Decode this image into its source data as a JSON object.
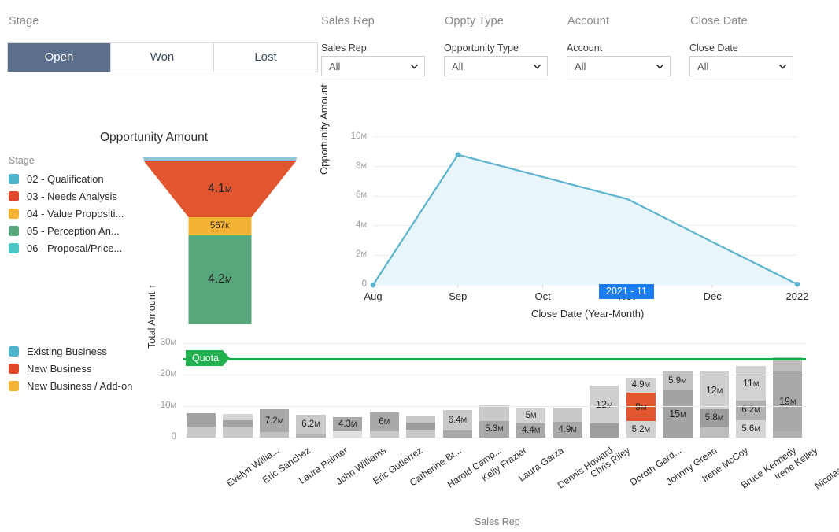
{
  "filters": {
    "stage": {
      "group_title": "Stage",
      "options": [
        "Open",
        "Won",
        "Lost"
      ],
      "selected": "Open"
    },
    "dropdowns": [
      {
        "group_title": "Sales Rep",
        "label": "Sales Rep",
        "value": "All",
        "icon": "chevron-down-icon"
      },
      {
        "group_title": "Oppty Type",
        "label": "Opportunity Type",
        "value": "All",
        "icon": "chevron-down-icon"
      },
      {
        "group_title": "Account",
        "label": "Account",
        "value": "All",
        "icon": "chevron-down-icon"
      },
      {
        "group_title": "Close Date",
        "label": "Close Date",
        "value": "All",
        "icon": "chevron-down-icon"
      }
    ]
  },
  "funnel_panel": {
    "title": "Opportunity Amount",
    "legend_title": "Stage",
    "legend": [
      {
        "label": "02 - Qualification",
        "color": "#4eb3cd"
      },
      {
        "label": "03 - Needs Analysis",
        "color": "#e1482b"
      },
      {
        "label": "04 - Value Propositi...",
        "color": "#f5b335"
      },
      {
        "label": "05 - Perception An...",
        "color": "#56a87c"
      },
      {
        "label": "06 - Proposal/Price...",
        "color": "#4ac6c6"
      }
    ]
  },
  "chart_data": [
    {
      "type": "funnel",
      "title": "Opportunity Amount",
      "stages": [
        {
          "label": "02 - Qualification",
          "value_label": "",
          "value": 0.03,
          "color": "#8fc5d4",
          "show_label": false
        },
        {
          "label": "03 - Needs Analysis",
          "value_label": "4.1M",
          "value": 4.1,
          "color": "#e1552f",
          "show_label": true
        },
        {
          "label": "04 - Value Propositi...",
          "value_label": "567K",
          "value": 0.567,
          "color": "#f5b335",
          "show_label": true
        },
        {
          "label": "05 - Perception An...",
          "value_label": "4.2M",
          "value": 4.2,
          "color": "#56a87c",
          "show_label": true
        }
      ]
    },
    {
      "type": "area",
      "title": "",
      "xlabel": "Close Date (Year-Month)",
      "ylabel": "Opportunity Amount",
      "x": [
        "Aug",
        "Sep",
        "Oct",
        "Nov",
        "Dec",
        "2022"
      ],
      "values": [
        0,
        8.8,
        7.3,
        5.8,
        2.9,
        0.05
      ],
      "ylim": [
        0,
        10
      ],
      "yticks": [
        "0",
        "2M",
        "4M",
        "6M",
        "8M",
        "10M"
      ],
      "grid": true,
      "line_color": "#5cb3cf",
      "fill_color": "#e8f5fa",
      "tooltip": "2021 - 11"
    },
    {
      "type": "bar",
      "stacked": true,
      "xlabel": "Sales Rep",
      "ylabel": "Total Amount ↑",
      "ylim": [
        0,
        30
      ],
      "yticks": [
        "0",
        "10M",
        "20M",
        "30M"
      ],
      "quota_label": "Quota",
      "quota_value": 25,
      "legend": [
        {
          "label": "Existing Business",
          "color": "#4eb3cd"
        },
        {
          "label": "New Business",
          "color": "#e1482b"
        },
        {
          "label": "New Business / Add-on",
          "color": "#f5b335"
        }
      ],
      "categories": [
        "Evelyn Willia...",
        "Eric Sanchez",
        "Laura Palmer",
        "John Williams",
        "Eric Gutierrez",
        "Catherine Br...",
        "Harold Camp...",
        "Kelly Frazier",
        "Laura Garza",
        "Dennis Howard",
        "Chris Riley",
        "Doroth Gard...",
        "Johnny Green",
        "Irene McCoy",
        "Bruce Kennedy",
        "Irene Kelley",
        "Nicolas Weaver"
      ],
      "bars": [
        {
          "name": "Evelyn Willia...",
          "segments": [
            {
              "value": 3.6,
              "label": "",
              "color": "#c9c9c9"
            },
            {
              "value": 4.1,
              "label": "",
              "color": "#a3a3a3"
            }
          ]
        },
        {
          "name": "Eric Sanchez",
          "segments": [
            {
              "value": 3.4,
              "label": "",
              "color": "#c9c9c9"
            },
            {
              "value": 2.1,
              "label": "",
              "color": "#a3a3a3"
            },
            {
              "value": 2.1,
              "label": "",
              "color": "#d6d6d6"
            }
          ]
        },
        {
          "name": "Laura Palmer",
          "segments": [
            {
              "value": 1.7,
              "label": "",
              "color": "#c0c0c0"
            },
            {
              "value": 7.2,
              "label": "7.2M",
              "color": "#a8a8a8"
            }
          ]
        },
        {
          "name": "John Williams",
          "segments": [
            {
              "value": 1.1,
              "label": "",
              "color": "#b4b4b4"
            },
            {
              "value": 6.2,
              "label": "6.2M",
              "color": "#c9c9c9"
            }
          ]
        },
        {
          "name": "Eric Gutierrez",
          "segments": [
            {
              "value": 2.1,
              "label": "",
              "color": "#e0e0e0"
            },
            {
              "value": 4.3,
              "label": "4.3M",
              "color": "#a8a8a8"
            }
          ]
        },
        {
          "name": "Catherine Br...",
          "segments": [
            {
              "value": 2.0,
              "label": "",
              "color": "#c9c9c9"
            },
            {
              "value": 6.0,
              "label": "6M",
              "color": "#a8a8a8"
            }
          ]
        },
        {
          "name": "Harold Camp...",
          "segments": [
            {
              "value": 2.5,
              "label": "",
              "color": "#c9c9c9"
            },
            {
              "value": 2.2,
              "label": "",
              "color": "#9d9d9d"
            },
            {
              "value": 2.4,
              "label": "",
              "color": "#c9c9c9"
            }
          ]
        },
        {
          "name": "Kelly Frazier",
          "segments": [
            {
              "value": 2.3,
              "label": "",
              "color": "#a8a8a8"
            },
            {
              "value": 6.4,
              "label": "6.4M",
              "color": "#c9c9c9"
            }
          ]
        },
        {
          "name": "Laura Garza",
          "segments": [
            {
              "value": 5.3,
              "label": "5.3M",
              "color": "#a8a8a8"
            },
            {
              "value": 5.0,
              "label": "",
              "color": "#c9c9c9"
            }
          ]
        },
        {
          "name": "Dennis Howard",
          "segments": [
            {
              "value": 4.4,
              "label": "4.4M",
              "color": "#a8a8a8"
            },
            {
              "value": 5.0,
              "label": "5M",
              "color": "#d2d2d2"
            }
          ]
        },
        {
          "name": "Chris Riley",
          "segments": [
            {
              "value": 4.9,
              "label": "4.9M",
              "color": "#a8a8a8"
            },
            {
              "value": 4.6,
              "label": "",
              "color": "#c9c9c9"
            }
          ]
        },
        {
          "name": "Doroth Gard...",
          "segments": [
            {
              "value": 4.6,
              "label": "",
              "color": "#9d9d9d"
            },
            {
              "value": 12.0,
              "label": "12M",
              "color": "#cfcfcf"
            }
          ]
        },
        {
          "name": "Johnny Green",
          "segments": [
            {
              "value": 5.2,
              "label": "5.2M",
              "color": "#d2d2d2"
            },
            {
              "value": 9.0,
              "label": "9M",
              "color": "#e1552f"
            },
            {
              "value": 4.9,
              "label": "4.9M",
              "color": "#d2d2d2"
            }
          ]
        },
        {
          "name": "Irene McCoy",
          "segments": [
            {
              "value": 15.0,
              "label": "15M",
              "color": "#a3a3a3"
            },
            {
              "value": 5.9,
              "label": "5.9M",
              "color": "#c2c2c2"
            }
          ]
        },
        {
          "name": "Bruce Kennedy",
          "segments": [
            {
              "value": 3.3,
              "label": "",
              "color": "#bdbdbd"
            },
            {
              "value": 5.8,
              "label": "5.8M",
              "color": "#9d9d9d"
            },
            {
              "value": 12.0,
              "label": "12M",
              "color": "#cfcfcf"
            }
          ]
        },
        {
          "name": "Irene Kelley",
          "segments": [
            {
              "value": 5.6,
              "label": "5.6M",
              "color": "#d6d6d6"
            },
            {
              "value": 6.2,
              "label": "6.2M",
              "color": "#b0b0b0"
            },
            {
              "value": 11.0,
              "label": "11M",
              "color": "#d2d2d2"
            }
          ]
        },
        {
          "name": "Nicolas Weaver",
          "segments": [
            {
              "value": 2.0,
              "label": "",
              "color": "#b0b0b0"
            },
            {
              "value": 19.0,
              "label": "19M",
              "color": "#a8a8a8"
            },
            {
              "value": 4.5,
              "label": "",
              "color": "#bdbdbd"
            }
          ]
        }
      ]
    }
  ]
}
